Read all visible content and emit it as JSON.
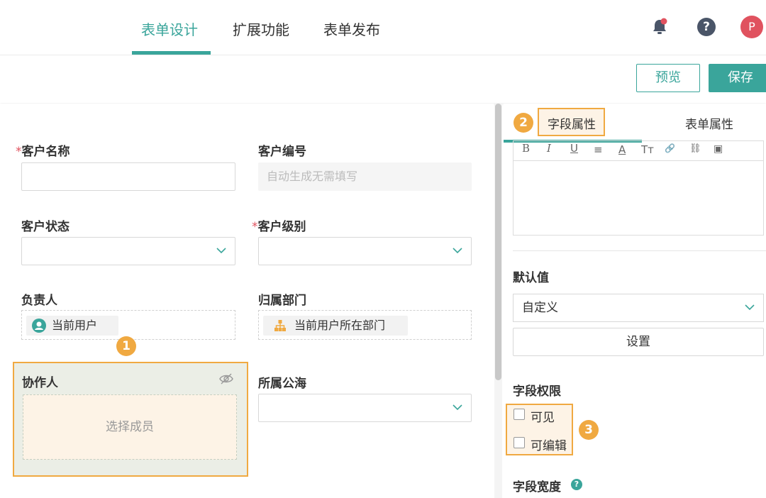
{
  "nav": {
    "tabs": [
      {
        "label": "表单设计",
        "active": true
      },
      {
        "label": "扩展功能",
        "active": false
      },
      {
        "label": "表单发布",
        "active": false
      }
    ],
    "avatar_letter": "P",
    "help_glyph": "?",
    "icons": [
      "bell-icon",
      "help-icon"
    ]
  },
  "toolbar": {
    "preview_label": "预览",
    "save_label": "保存"
  },
  "form": {
    "customer_name": {
      "label": "客户名称",
      "required": true,
      "value": ""
    },
    "customer_no": {
      "label": "客户编号",
      "placeholder": "自动生成无需填写"
    },
    "customer_status": {
      "label": "客户状态",
      "value": ""
    },
    "customer_level": {
      "label": "客户级别",
      "required": true,
      "value": ""
    },
    "owner": {
      "label": "负责人",
      "chip": "当前用户"
    },
    "department": {
      "label": "归属部门",
      "chip": "当前用户所在部门"
    },
    "collaborator": {
      "label": "协作人",
      "placeholder": "选择成员"
    },
    "public_sea": {
      "label": "所属公海",
      "value": ""
    },
    "required_mark": "*"
  },
  "annotations": {
    "badge1": "1",
    "badge2": "2",
    "badge3": "3"
  },
  "panel": {
    "tab_field": "字段属性",
    "tab_form": "表单属性",
    "editor_tools": [
      "B",
      "I",
      "U",
      "≡",
      "A",
      "Tт",
      "🔗",
      "⛓",
      "▣"
    ],
    "default_value": {
      "label": "默认值",
      "selected": "自定义",
      "set_button": "设置"
    },
    "permission": {
      "label": "字段权限",
      "visible": "可见",
      "editable": "可编辑"
    },
    "width": {
      "label": "字段宽度",
      "help": "?"
    }
  },
  "colors": {
    "accent": "#3aa59b",
    "highlight": "#f0a941",
    "required": "#e0525f"
  }
}
